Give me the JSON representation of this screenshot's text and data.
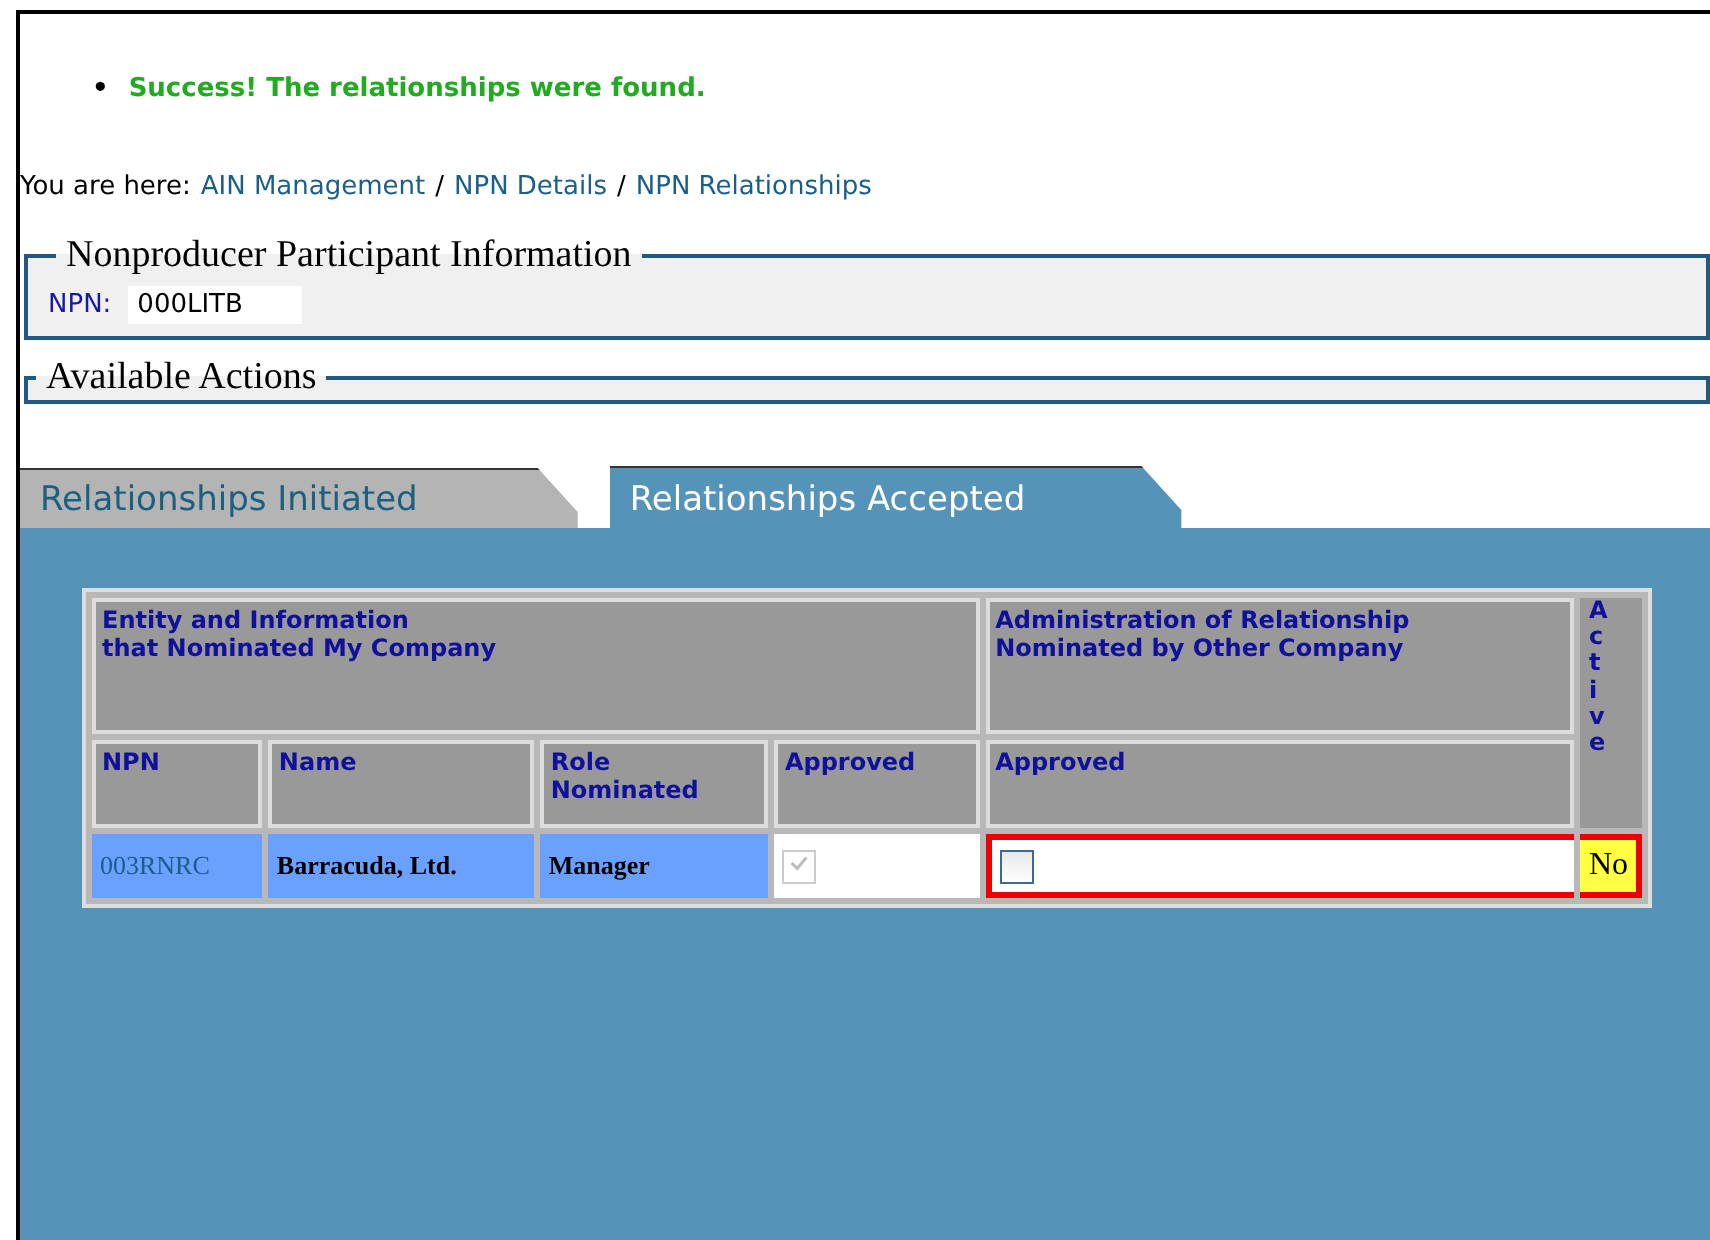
{
  "messages": [
    {
      "bullet": "•",
      "text": "Success! The relationships were found."
    }
  ],
  "breadcrumb": {
    "label": "You are here:",
    "links": [
      "AIN Management",
      "NPN Details",
      "NPN Relationships"
    ],
    "separator": "/"
  },
  "participant_info": {
    "title": "Nonproducer Participant Information",
    "npn_label": "NPN:",
    "npn_value": "000LITB"
  },
  "available_actions": {
    "title": "Available Actions"
  },
  "tabs": [
    {
      "label": "Relationships Initiated",
      "selected": false
    },
    {
      "label": "Relationships Accepted",
      "selected": true
    }
  ],
  "table": {
    "group_headers": [
      "Entity and Information\nthat Nominated My Company",
      "Administration of Relationship\nNominated by Other Company"
    ],
    "active_header": "Active",
    "columns": [
      "NPN",
      "Name",
      "Role\nNominated",
      "Approved",
      "Approved"
    ],
    "rows": [
      {
        "npn": "003RNRC",
        "name": "Barracuda, Ltd.",
        "role": "Manager",
        "approved": true,
        "approved_disabled": true,
        "admin_approved": false,
        "active": "No",
        "highlighted": true
      }
    ]
  }
}
